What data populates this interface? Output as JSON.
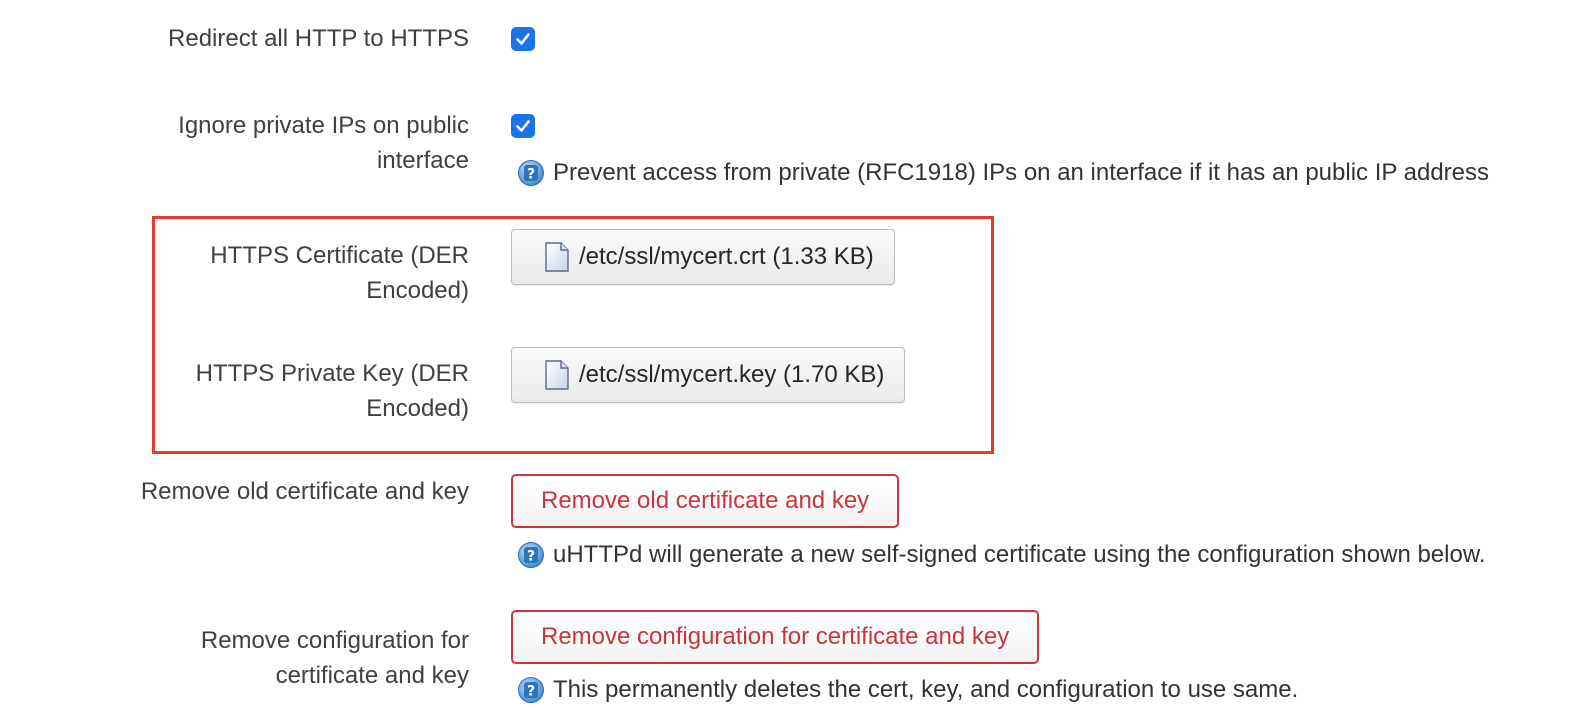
{
  "settings": {
    "redirect": {
      "label": "Redirect all HTTP to HTTPS",
      "checked": true
    },
    "ignore_private": {
      "label_line1": "Ignore private IPs on public",
      "label_line2": "interface",
      "checked": true,
      "help": "Prevent access from private (RFC1918) IPs on an interface if it has an public IP address"
    },
    "cert": {
      "label_line1": "HTTPS Certificate (DER",
      "label_line2": "Encoded)",
      "file": "/etc/ssl/mycert.crt (1.33 KB)"
    },
    "key": {
      "label_line1": "HTTPS Private Key (DER",
      "label_line2": "Encoded)",
      "file": "/etc/ssl/mycert.key (1.70 KB)"
    },
    "remove_old": {
      "label": "Remove old certificate and key",
      "button": "Remove old certificate and key",
      "help": "uHTTPd will generate a new self-signed certificate using the configuration shown below."
    },
    "remove_config": {
      "label_line1": "Remove configuration for",
      "label_line2": "certificate and key",
      "button": "Remove configuration for certificate and key",
      "help": "This permanently deletes the cert, key, and configuration to use same."
    }
  },
  "colors": {
    "checkbox": "#1a73e8",
    "danger": "#c9363e",
    "highlight": "#e53935",
    "label_text": "#404040"
  },
  "icons": {
    "help": "help-question-icon",
    "file": "file-icon",
    "check": "checkmark-icon"
  }
}
